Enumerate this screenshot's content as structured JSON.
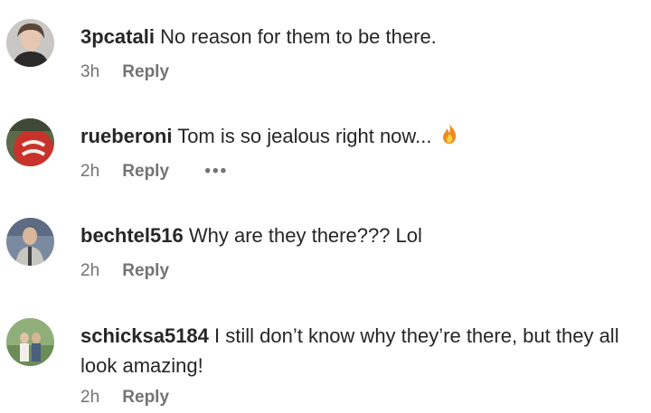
{
  "comments": [
    {
      "username": "3pcatali",
      "text": "No reason for them to be there.",
      "time": "3h",
      "reply": "Reply"
    },
    {
      "username": "rueberoni",
      "text": "Tom is so jealous right now...",
      "emoji": "fire-icon",
      "time": "2h",
      "reply": "Reply",
      "more": "•••"
    },
    {
      "username": "bechtel516",
      "text": "Why are they there??? Lol",
      "time": "2h",
      "reply": "Reply"
    },
    {
      "username": "schicksa5184",
      "text": "I still don’t know why they’re there, but they all",
      "text_line2": "look amazing!",
      "time": "2h",
      "reply": "Reply"
    }
  ],
  "colors": {
    "username": "#262626",
    "text": "#262626",
    "meta": "#737373",
    "accent_fire": "#f28b1c"
  }
}
